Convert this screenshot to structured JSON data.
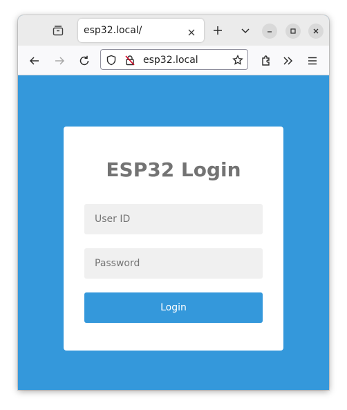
{
  "browser": {
    "tab": {
      "title": "esp32.local/"
    },
    "url": "esp32.local"
  },
  "login": {
    "title": "ESP32 Login",
    "user_id_placeholder": "User ID",
    "user_id_value": "",
    "password_placeholder": "Password",
    "password_value": "",
    "button_label": "Login"
  },
  "colors": {
    "page_background": "#3498db",
    "accent": "#3498db",
    "card": "#ffffff",
    "title_text": "#737373",
    "field_background": "#f0f0f0"
  },
  "icons": [
    "tabs-overview-icon",
    "close-icon",
    "plus-icon",
    "chevron-down-icon",
    "minimize-icon",
    "maximize-icon",
    "close-window-icon",
    "arrow-left-icon",
    "arrow-right-icon",
    "reload-icon",
    "shield-icon",
    "insecure-lock-icon",
    "star-icon",
    "extensions-icon",
    "overflow-chevrons-icon",
    "menu-icon"
  ]
}
